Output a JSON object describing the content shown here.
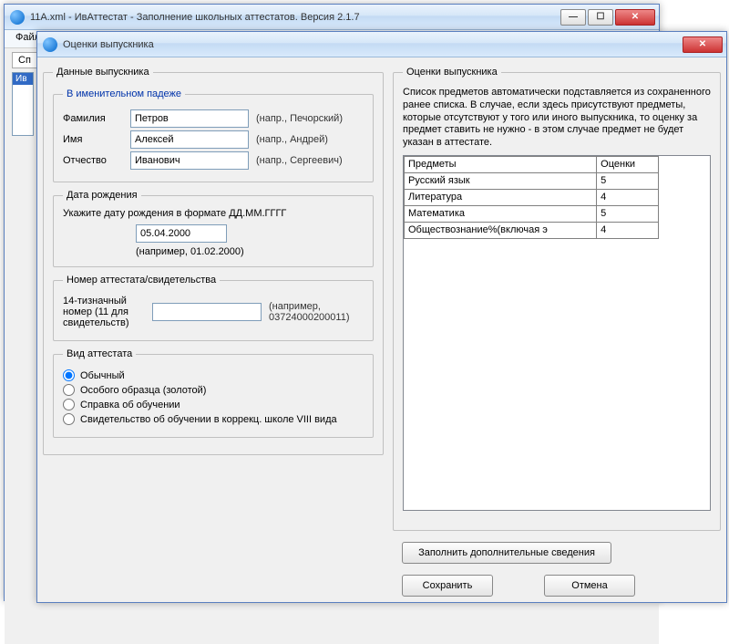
{
  "main_window": {
    "title": "11А.xml - ИвАттестат - Заполнение школьных аттестатов. Версия 2.1.7",
    "menu_file": "Файл",
    "tab_label": "Сп",
    "list_sel": "Ив"
  },
  "dialog": {
    "title": "Оценки выпускника",
    "grad_data_legend": "Данные выпускника",
    "nominative_legend": "В именительном падеже",
    "surname_label": "Фамилия",
    "surname_value": "Петров",
    "surname_hint": "(напр., Печорский)",
    "name_label": "Имя",
    "name_value": "Алексей",
    "name_hint": "(напр., Андрей)",
    "patr_label": "Отчество",
    "patr_value": "Иванович",
    "patr_hint": "(напр., Сергеевич)",
    "dob_legend": "Дата рождения",
    "dob_prompt": "Укажите дату рождения в формате ДД.ММ.ГГГГ",
    "dob_value": "05.04.2000",
    "dob_hint": "(например, 01.02.2000)",
    "num_legend": "Номер аттестата/свидетельства",
    "num_label": "14-тизначный номер (11 для свидетельств)",
    "num_value": "",
    "num_hint": "(например, 03724000200011)",
    "kind_legend": "Вид аттестата",
    "kind_opts": [
      "Обычный",
      "Особого образца (золотой)",
      "Справка об обучении",
      "Свидетельство об обучении в коррекц. школе VIII вида"
    ],
    "kind_selected": 0,
    "grades_legend": "Оценки выпускника",
    "grades_note": "Список предметов автоматически подставляется из сохраненного ранее списка. В случае, если здесь присутствуют предметы, которые отсутствуют у того или иного выпускника, то оценку за предмет ставить не нужно - в этом случае предмет не будет указан в аттестате.",
    "col_subject": "Предметы",
    "col_grade": "Оценки",
    "grades": [
      {
        "subject": "Русский язык",
        "grade": "5"
      },
      {
        "subject": "Литература",
        "grade": "4"
      },
      {
        "subject": "Математика",
        "grade": "5"
      },
      {
        "subject": "Обществознание%(включая э",
        "grade": "4"
      }
    ],
    "btn_fill": "Заполнить дополнительные сведения",
    "btn_save": "Сохранить",
    "btn_cancel": "Отмена"
  }
}
